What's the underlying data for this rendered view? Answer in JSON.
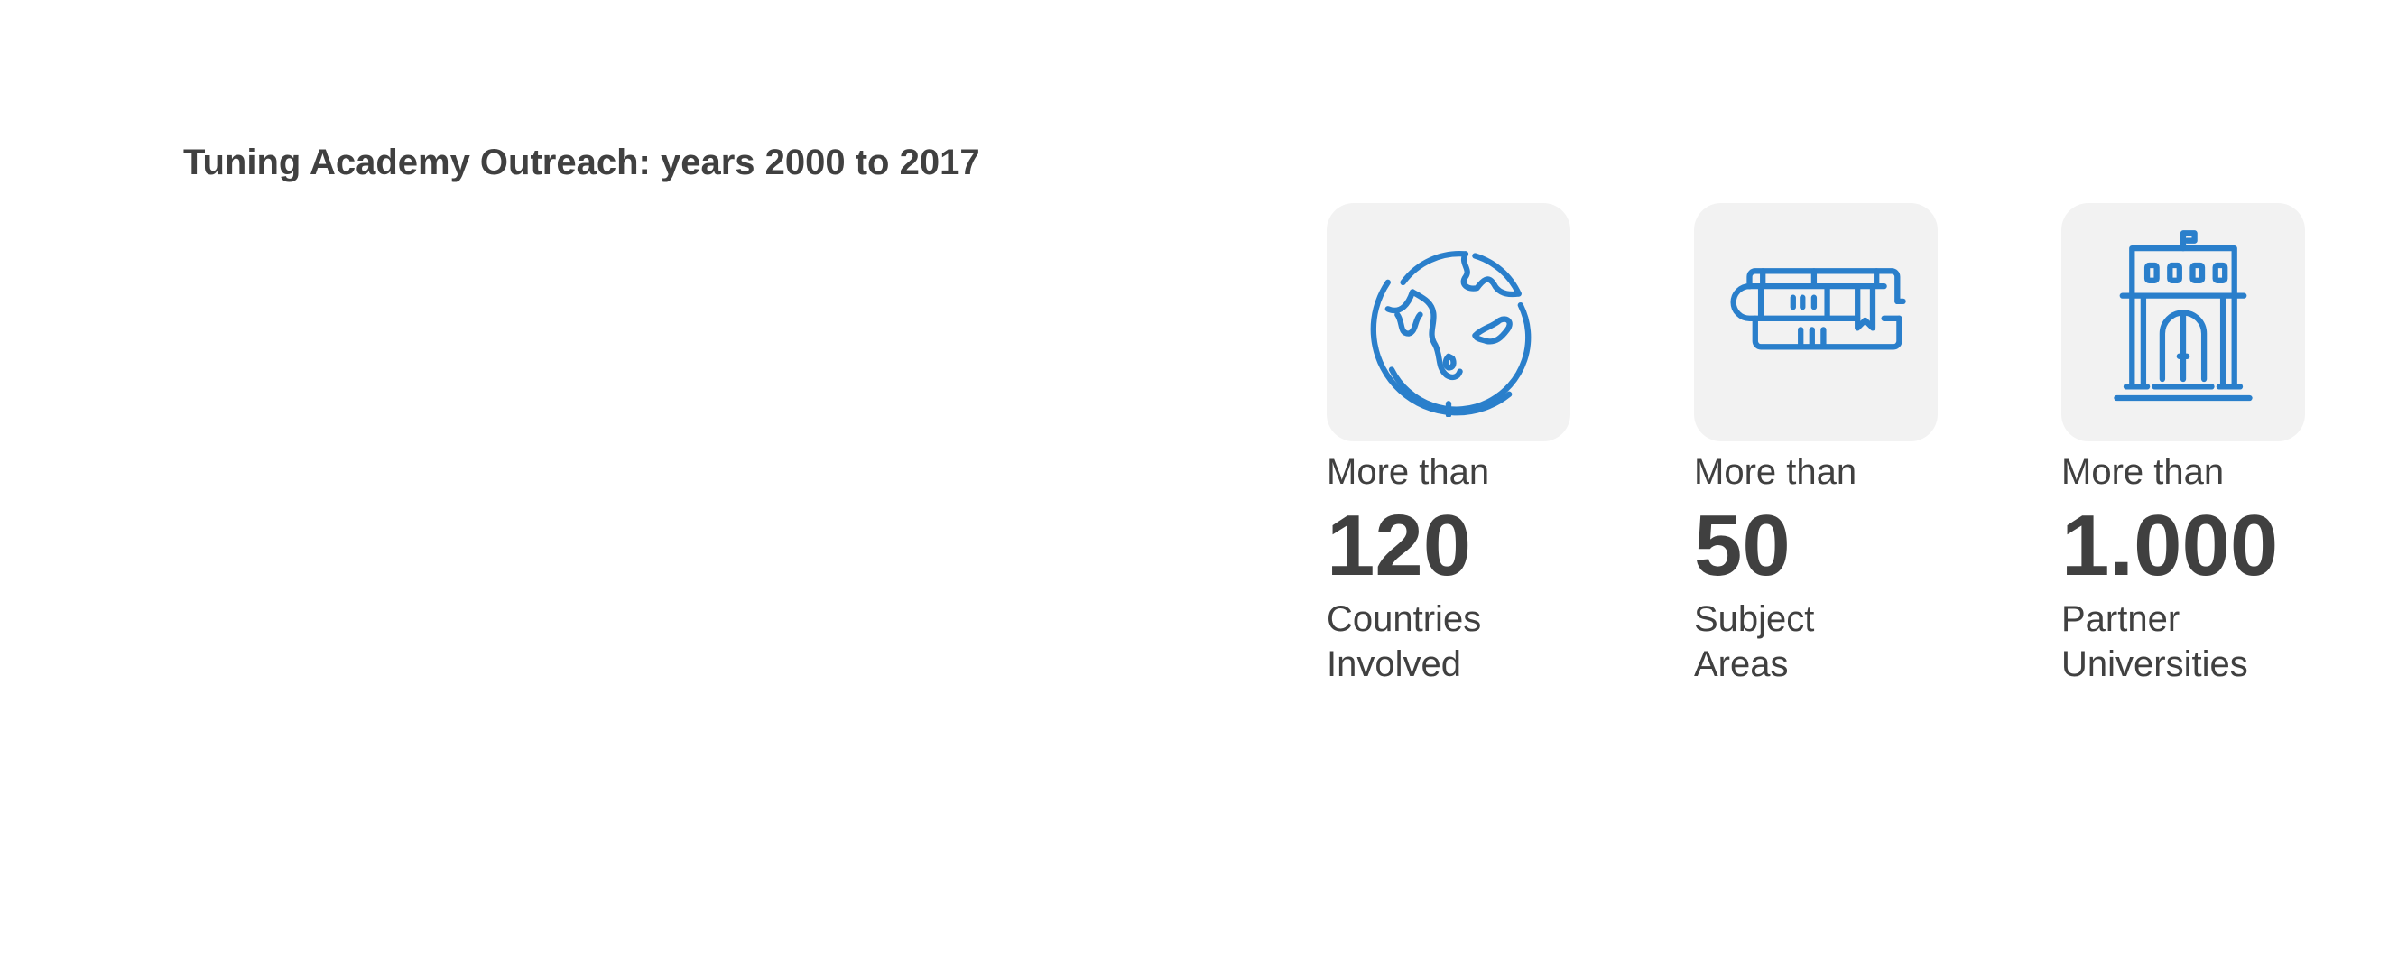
{
  "title": "Tuning Academy Outreach: years 2000 to 2017",
  "colors": {
    "icon_stroke": "#2a7fcb",
    "tile_background": "#f2f2f2",
    "text": "#404040"
  },
  "stats": [
    {
      "icon": "globe-icon",
      "prefix": "More than",
      "value": "120",
      "caption_line1": "Countries",
      "caption_line2": "Involved"
    },
    {
      "icon": "books-icon",
      "prefix": "More than",
      "value": "50",
      "caption_line1": "Subject",
      "caption_line2": "Areas"
    },
    {
      "icon": "university-icon",
      "prefix": "More than",
      "value": "1.000",
      "caption_line1": "Partner",
      "caption_line2": "Universities"
    }
  ]
}
